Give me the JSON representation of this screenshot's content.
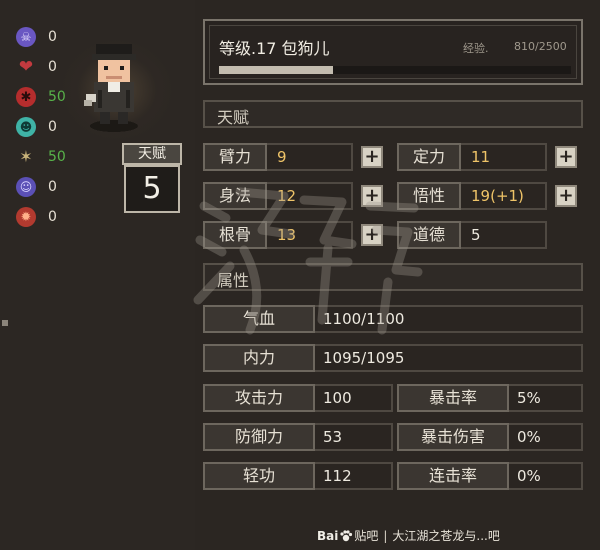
{
  "status_effects": [
    {
      "icon": "skull-icon",
      "color": "#6a57c2",
      "value": "0",
      "green": false
    },
    {
      "icon": "broken-heart-icon",
      "color": "#c33a3f",
      "value": "0",
      "green": false
    },
    {
      "icon": "spider-icon",
      "color": "#b52d2d",
      "value": "50",
      "green": true
    },
    {
      "icon": "ghost-icon",
      "color": "#3fb3a6",
      "value": "0",
      "green": false
    },
    {
      "icon": "sparkle-icon",
      "color": "#c9b37a",
      "value": "50",
      "green": true
    },
    {
      "icon": "purple-orb-icon",
      "color": "#5b50b6",
      "value": "0",
      "green": false
    },
    {
      "icon": "flame-icon",
      "color": "#b23a2f",
      "value": "0",
      "green": false
    }
  ],
  "talent": {
    "title": "天赋",
    "value": "5"
  },
  "level": {
    "title": "等级.17 包狗儿",
    "exp_label": "经验.",
    "exp_value": "810/2500",
    "exp_progress": 0.324
  },
  "talent_section": {
    "title": "天赋"
  },
  "attributes": [
    {
      "label": "臂力",
      "value": "9"
    },
    {
      "label": "定力",
      "value": "11"
    },
    {
      "label": "身法",
      "value": "12"
    },
    {
      "label": "悟性",
      "value": "19(+1)"
    },
    {
      "label": "根骨",
      "value": "13"
    },
    {
      "label": "道德",
      "value": "5"
    }
  ],
  "property_section": {
    "title": "属性"
  },
  "stats": {
    "hp": {
      "label": "气血",
      "value": "1100/1100"
    },
    "mp": {
      "label": "内力",
      "value": "1095/1095"
    },
    "attack": {
      "label": "攻击力",
      "value": "100"
    },
    "crit_rate": {
      "label": "暴击率",
      "value": "5%"
    },
    "defense": {
      "label": "防御力",
      "value": "53"
    },
    "crit_damage": {
      "label": "暴击伤害",
      "value": "0%"
    },
    "qinggong": {
      "label": "轻功",
      "value": "112"
    },
    "combo_rate": {
      "label": "连击率",
      "value": "0%"
    }
  },
  "footer": {
    "baidu_a": "Bai",
    "baidu_b": "贴吧",
    "separator": "|",
    "forum": "大江湖之苍龙与...吧"
  },
  "colors": {
    "gold_value": "#efc468",
    "green_value": "#58b34a",
    "exp_fill": "#c3bcaf"
  }
}
